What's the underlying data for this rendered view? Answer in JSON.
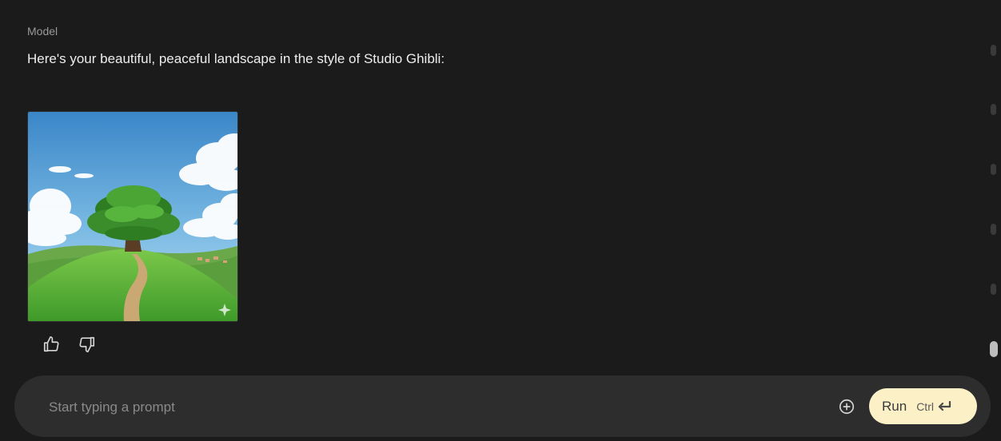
{
  "message": {
    "role_label": "Model",
    "text": "Here's your beautiful, peaceful landscape in the style of Studio Ghibli:"
  },
  "image": {
    "subject": "Ghibli-style landscape: large green tree on a grassy hill with a winding dirt path, blue sky with white clouds",
    "colors": {
      "sky_top": "#3f8fcf",
      "sky_bottom": "#a9d6ef",
      "grass": "#5fb33c",
      "foliage": "#3f9a2e",
      "path": "#c9a873"
    }
  },
  "feedback": {
    "up_icon": "thumbs-up-icon",
    "down_icon": "thumbs-down-icon"
  },
  "prompt": {
    "placeholder": "Start typing a prompt",
    "value": "",
    "add_icon": "add-circle-icon",
    "run_label": "Run",
    "shortcut_label": "Ctrl",
    "enter_icon": "enter-arrow-icon"
  },
  "colors": {
    "background": "#1b1b1b",
    "prompt_bar": "#2d2d2d",
    "run_button": "#fbf0c6"
  }
}
